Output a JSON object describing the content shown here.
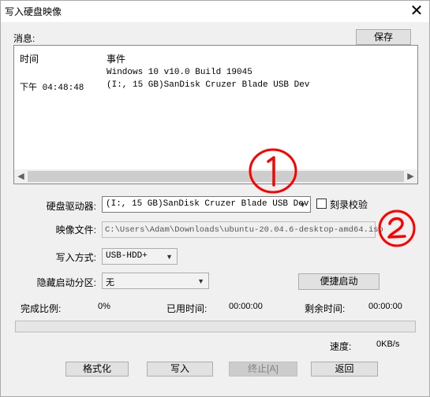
{
  "window": {
    "title": "写入硬盘映像",
    "close_glyph": "✕"
  },
  "messages": {
    "label": "消息:",
    "save_button": "保存",
    "col_time": "时间",
    "col_event": "事件",
    "rows": [
      {
        "time": "",
        "event": "Windows 10 v10.0 Build 19045"
      },
      {
        "time": "下午 04:48:48",
        "event": "(I:, 15 GB)SanDisk Cruzer Blade USB Dev"
      }
    ]
  },
  "form": {
    "drive_label": "硬盘驱动器:",
    "drive_value": "(I:, 15 GB)SanDisk Cruzer Blade USB Dev",
    "verify_label": "刻录校验",
    "verify_checked": false,
    "image_label": "映像文件:",
    "image_value": "C:\\Users\\Adam\\Downloads\\ubuntu-20.04.6-desktop-amd64.iso",
    "method_label": "写入方式:",
    "method_value": "USB-HDD+",
    "hidden_label": "隐藏启动分区:",
    "hidden_value": "无",
    "quick_boot_button": "便捷启动"
  },
  "status": {
    "done_label": "完成比例:",
    "done_value": "0%",
    "elapsed_label": "已用时间:",
    "elapsed_value": "00:00:00",
    "remaining_label": "剩余时间:",
    "remaining_value": "00:00:00",
    "progress": 0,
    "speed_label": "速度:",
    "speed_value": "0KB/s"
  },
  "actions": {
    "format": "格式化",
    "write": "写入",
    "abort": "终止[A]",
    "back": "返回"
  },
  "annotations": {
    "mark_1": "1",
    "mark_2": "2",
    "color": "#ff0000"
  }
}
